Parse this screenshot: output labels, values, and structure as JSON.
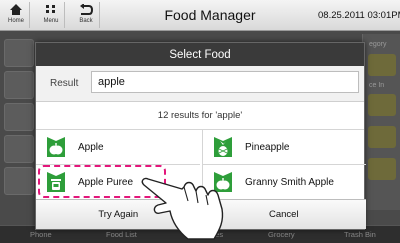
{
  "topbar": {
    "home_label": "Home",
    "menu_label": "Menu",
    "back_label": "Back",
    "title": "Food Manager",
    "datetime": "08.25.2011 03:01PM"
  },
  "background": {
    "right_panel_label": "egory",
    "right_panel_label2": "ce In",
    "bottom_items": [
      "Phone",
      "Food List",
      "Recipes",
      "Grocery",
      "Trash Bin"
    ]
  },
  "dialog": {
    "title": "Select Food",
    "result_label": "Result",
    "result_value": "apple",
    "count_text": "12 results for 'apple'",
    "items": [
      {
        "name": "Apple",
        "icon": "apple-icon"
      },
      {
        "name": "Pineapple",
        "icon": "pineapple-icon"
      },
      {
        "name": "Apple Puree",
        "icon": "puree-jar-icon"
      },
      {
        "name": "Granny Smith Apple",
        "icon": "apple-icon"
      }
    ],
    "try_again_label": "Try Again",
    "cancel_label": "Cancel"
  },
  "colors": {
    "accent_green": "#2e9e3a",
    "highlight_pink": "#e3167b"
  }
}
